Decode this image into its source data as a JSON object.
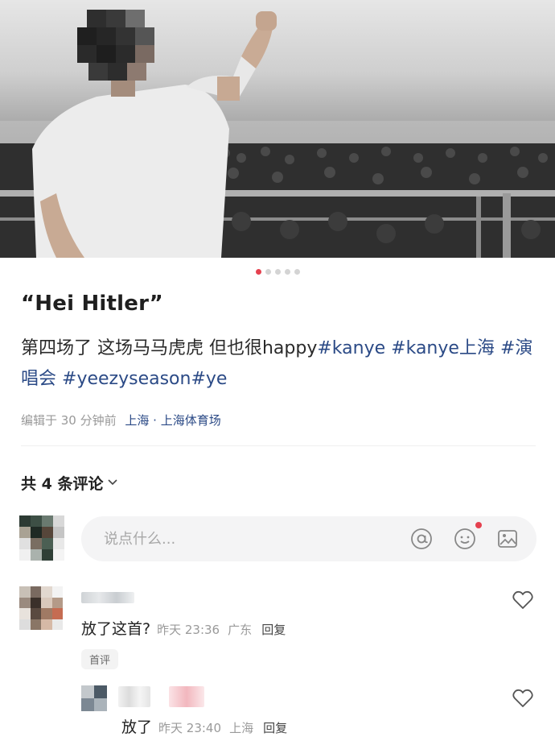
{
  "post": {
    "title": "“Hei Hitler”",
    "body_prefix": "第四场了 这场马马虎虎 但也很happy",
    "tags": [
      "#kanye",
      "#kanye上海",
      "#演唱会",
      "#yeezyseason",
      "#ye"
    ],
    "edited": "编辑于 30 分钟前",
    "location": "上海 · 上海体育场"
  },
  "carousel": {
    "count": 5,
    "active": 0
  },
  "comments": {
    "count_label": "共 4 条评论",
    "input_placeholder": "说点什么...",
    "items": [
      {
        "text": "放了这首?",
        "time": "昨天 23:36",
        "region": "广东",
        "reply": "回复",
        "badge": "首评"
      },
      {
        "text": "放了",
        "time": "昨天 23:40",
        "region": "上海",
        "reply": "回复"
      }
    ]
  },
  "icons": [
    "at-icon",
    "emoji-icon",
    "image-icon",
    "heart-icon",
    "chevron-down-icon"
  ],
  "colors": {
    "accent": "#e5414f",
    "tag_blue": "#2b4a86"
  }
}
